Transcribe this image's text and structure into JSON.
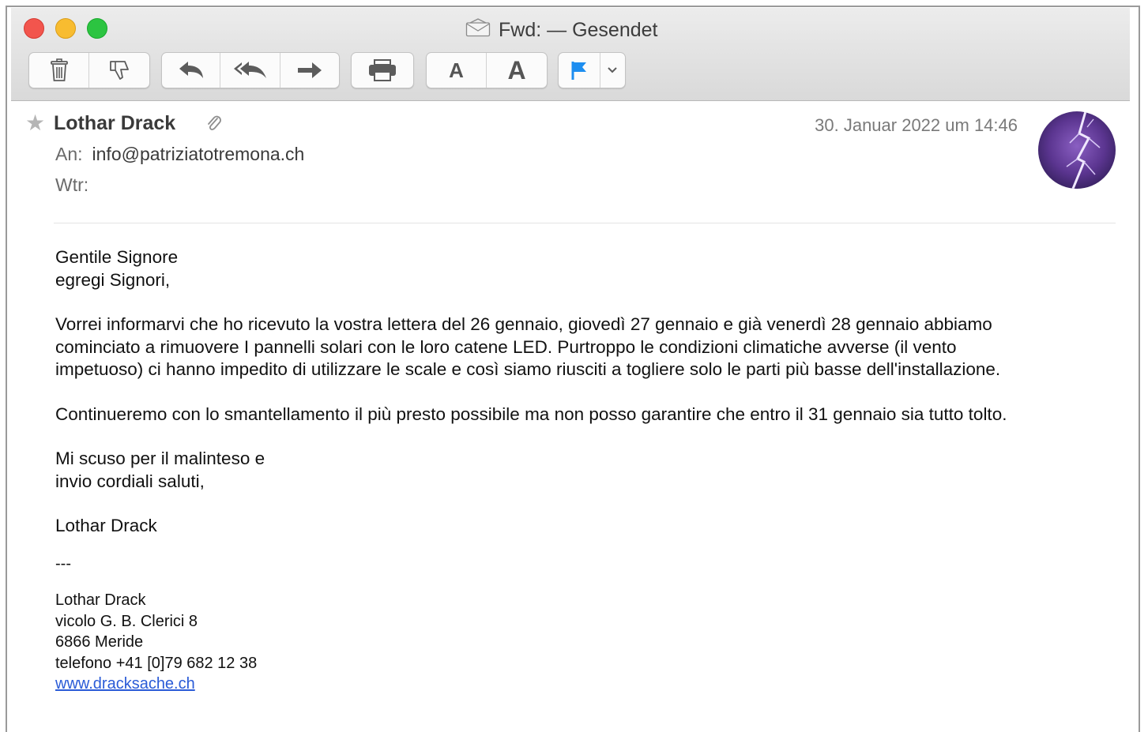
{
  "window": {
    "title": "Fwd: — Gesendet"
  },
  "toolbar": {
    "font_smaller": "A",
    "font_larger": "A"
  },
  "message": {
    "sender": "Lothar Drack",
    "date": "30. Januar 2022 um 14:46",
    "to_label": "An:",
    "to_value": "info@patriziatotremona.ch",
    "cc_label": "Wtr:",
    "cc_value": ""
  },
  "body": {
    "greeting_1": "Gentile Signore",
    "greeting_2": "egregi Signori,",
    "para1_line1": "Vorrei informarvi che ho ricevuto la vostra lettera del 26 gennaio, giovedì 27 gennaio e già venerdì 28 gennaio abbiamo",
    "para1_line2": "cominciato a rimuovere I pannelli solari con le loro catene LED. Purtroppo le condizioni climatiche avverse (il vento",
    "para1_line3": "impetuoso) ci hanno impedito di utilizzare le scale e così siamo riusciti a togliere solo le parti più basse dell'installazione.",
    "para2": "Continueremo con lo smantellamento il più presto possibile ma non posso garantire che entro il 31 gennaio sia tutto tolto.",
    "closing_1": "Mi scuso per il malinteso e",
    "closing_2": "invio cordiali saluti,",
    "signature_name": "Lothar Drack",
    "divider": "---"
  },
  "signature": {
    "name": "Lothar Drack",
    "address_1": "vicolo G. B. Clerici 8",
    "address_2": "6866 Meride",
    "phone": "telefono +41 [0]79 682 12 38",
    "website": "www.dracksache.ch"
  },
  "colors": {
    "close": "#f2554d",
    "minimize": "#f8bc30",
    "maximize": "#2cc441",
    "flag": "#1d8ef0",
    "link": "#2a5bd7"
  }
}
